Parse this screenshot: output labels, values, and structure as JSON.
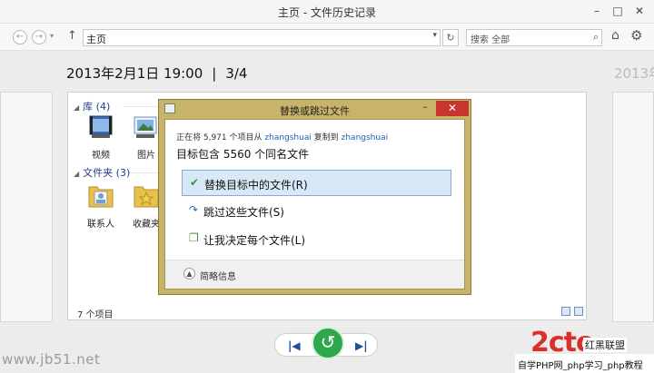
{
  "window": {
    "title": "主页 - 文件历史记录"
  },
  "nav": {
    "back_icon": "back-arrow-icon",
    "forward_icon": "forward-arrow-icon",
    "up_icon": "up-arrow-icon",
    "address": "主页",
    "search_placeholder": "搜索 全部"
  },
  "snapshot": {
    "date": "2013年2月1日 19:00",
    "sep": "|",
    "position": "3/4",
    "next_date": "2013年"
  },
  "library": {
    "libraries_header": "库 (4)",
    "libraries": [
      {
        "label": "视频"
      },
      {
        "label": "图片"
      }
    ],
    "folders_header": "文件夹 (3)",
    "folders": [
      {
        "label": "联系人"
      },
      {
        "label": "收藏夹"
      }
    ],
    "status": "7 个项目"
  },
  "dialog": {
    "title": "替换或跳过文件",
    "copy_prefix": "正在将 5,971 个项目从",
    "copy_source": "zhangshuai",
    "copy_mid": "复制到",
    "copy_dest": "zhangshuai",
    "headline": "目标包含 5560 个同名文件",
    "options": [
      {
        "label": "替换目标中的文件(R)"
      },
      {
        "label": "跳过这些文件(S)"
      },
      {
        "label": "让我决定每个文件(L)"
      }
    ],
    "details": "简略信息"
  },
  "watermarks": {
    "left": "www.jb51.net",
    "logo": "2cto",
    "tag": "红黑联盟",
    "bottom": "自学PHP网_php学习_php教程"
  },
  "colors": {
    "dialog_frame": "#c8b36a",
    "close_red": "#c7352c",
    "restore_green": "#2ea84b",
    "link_blue": "#1b5fb5"
  }
}
